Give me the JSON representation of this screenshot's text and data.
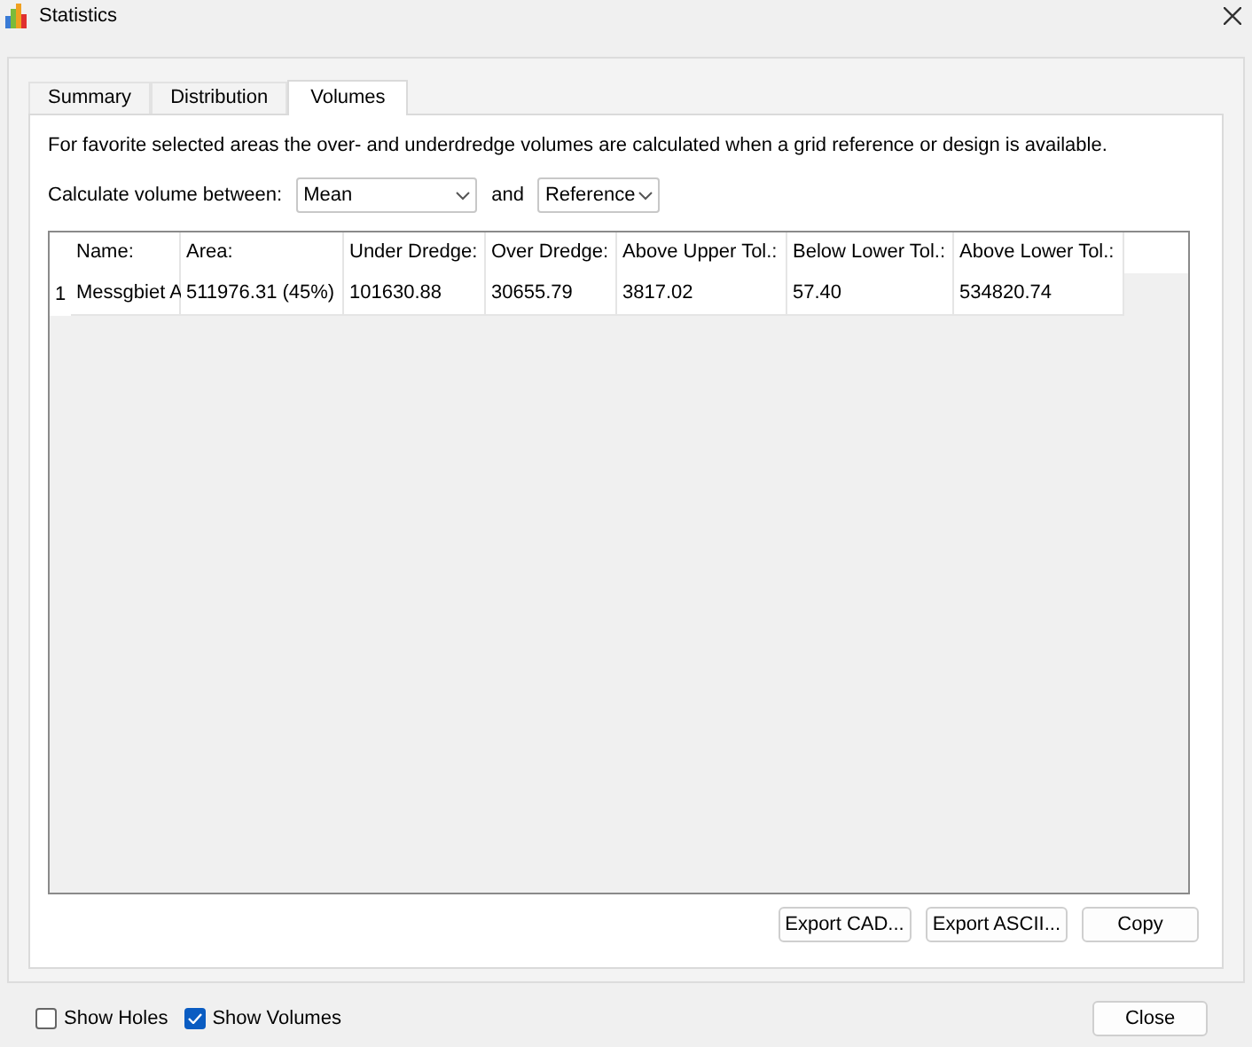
{
  "window": {
    "title": "Statistics"
  },
  "tabs": [
    {
      "label": "Summary",
      "selected": false
    },
    {
      "label": "Distribution",
      "selected": false
    },
    {
      "label": "Volumes",
      "selected": true
    }
  ],
  "description": "For favorite selected areas the over- and underdredge volumes are calculated when a grid reference or design is available.",
  "calc": {
    "label": "Calculate volume between:",
    "from": "Mean",
    "joiner": "and",
    "to": "Reference"
  },
  "table": {
    "columns": [
      "Name:",
      "Area:",
      "Under Dredge:",
      "Over Dredge:",
      "Above Upper Tol.:",
      "Below Lower Tol.:",
      "Above Lower Tol.:"
    ],
    "rows": [
      {
        "index": "1",
        "cells": [
          "Messgbiet A",
          "511976.31 (45%)",
          "101630.88",
          "30655.79",
          "3817.02",
          "57.40",
          "534820.74"
        ]
      }
    ]
  },
  "panel_buttons": [
    "Export CAD...",
    "Export ASCII...",
    "Copy"
  ],
  "checkboxes": [
    {
      "label": "Show Holes",
      "checked": false
    },
    {
      "label": "Show Volumes",
      "checked": true
    }
  ],
  "close_button": "Close"
}
